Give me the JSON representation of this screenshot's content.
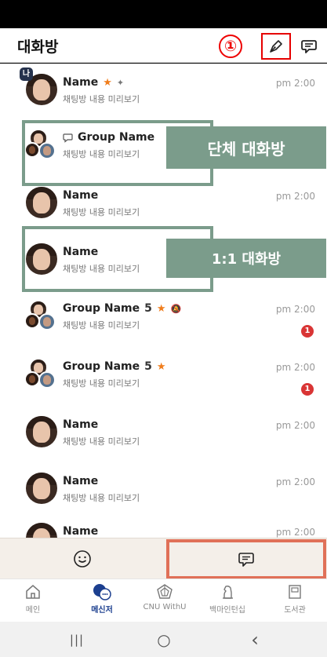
{
  "header": {
    "title": "대화방",
    "step_marker": "①",
    "compose_icon": "pen-icon",
    "new_chat_icon": "speech-bubble-icon"
  },
  "chats": [
    {
      "name": "Name",
      "preview": "채팅방 내용 미리보기",
      "time": "pm 2:00",
      "me_badge": "나",
      "starred": true,
      "pinned": true,
      "avatar": "single"
    },
    {
      "name": "Group Name",
      "preview": "채팅방 내용 미리보기",
      "time": "",
      "avatar": "group",
      "group_icon": true
    },
    {
      "name": "Name",
      "preview": "채팅방 내용 미리보기",
      "time": "pm 2:00",
      "avatar": "single"
    },
    {
      "name": "Name",
      "preview": "채팅방 내용 미리보기",
      "time": "",
      "avatar": "single"
    },
    {
      "name": "Group Name",
      "count": "5",
      "preview": "채팅방 내용 미리보기",
      "time": "pm 2:00",
      "starred": true,
      "muted": true,
      "unread": "1",
      "avatar": "group"
    },
    {
      "name": "Group Name",
      "count": "5",
      "preview": "채팅방 내용 미리보기",
      "time": "pm 2:00",
      "starred": true,
      "unread": "1",
      "avatar": "group"
    },
    {
      "name": "Name",
      "preview": "채팅방 내용 미리보기",
      "time": "pm 2:00",
      "avatar": "single"
    },
    {
      "name": "Name",
      "preview": "채팅방 내용 미리보기",
      "time": "pm 2:00",
      "avatar": "single"
    },
    {
      "name": "Name",
      "preview": "",
      "time": "pm 2:00",
      "avatar": "single"
    }
  ],
  "annotations": {
    "group_label": "단체 대화방",
    "direct_label": "1:1 대화방",
    "color": "#7b9c8b"
  },
  "bottom_toggle": {
    "emoji_icon": "smiley-icon",
    "chat_icon": "speech-bubble-icon",
    "highlight_color": "#e07058"
  },
  "tabs": [
    {
      "label": "메인",
      "icon": "home-icon",
      "active": false
    },
    {
      "label": "메신저",
      "icon": "messenger-icon",
      "active": true
    },
    {
      "label": "CNU WithU",
      "icon": "emblem-icon",
      "active": false
    },
    {
      "label": "백마인턴십",
      "icon": "horse-icon",
      "active": false
    },
    {
      "label": "도서관",
      "icon": "book-icon",
      "active": false
    }
  ],
  "navbar": {
    "recent_glyph": "|||",
    "home_glyph": "○",
    "back_glyph": "‹"
  },
  "colors": {
    "accent": "#1c3f8f",
    "star": "#f07d1c",
    "unread": "#d93535",
    "header_border": "#e60000"
  }
}
